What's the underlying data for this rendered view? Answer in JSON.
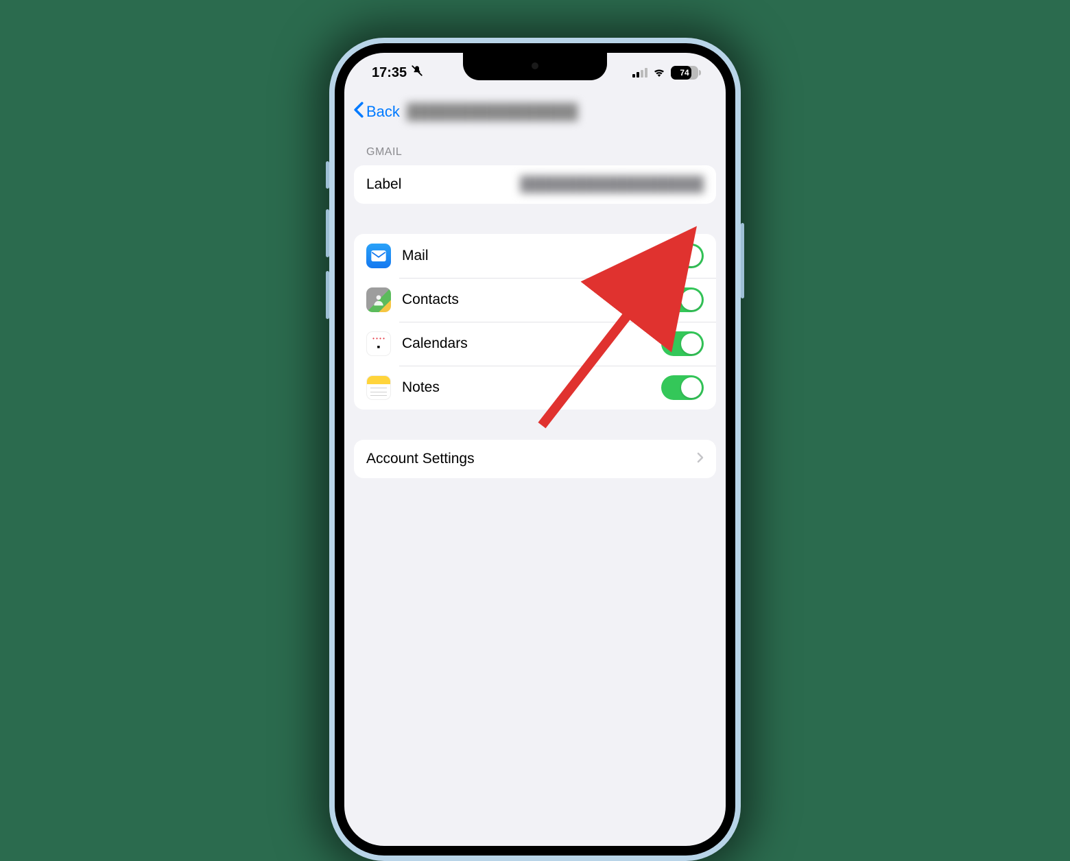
{
  "status": {
    "time": "17:35",
    "battery_percent": "74"
  },
  "nav": {
    "back_label": "Back",
    "title_blurred": "████████████████"
  },
  "section_label": "GMAIL",
  "label_row": {
    "title": "Label",
    "value_blurred": "██████████████████"
  },
  "services": [
    {
      "name": "Mail",
      "icon": "mail",
      "on": true
    },
    {
      "name": "Contacts",
      "icon": "contacts",
      "on": true
    },
    {
      "name": "Calendars",
      "icon": "calendar",
      "on": true
    },
    {
      "name": "Notes",
      "icon": "notes",
      "on": true
    }
  ],
  "account_settings_label": "Account Settings"
}
